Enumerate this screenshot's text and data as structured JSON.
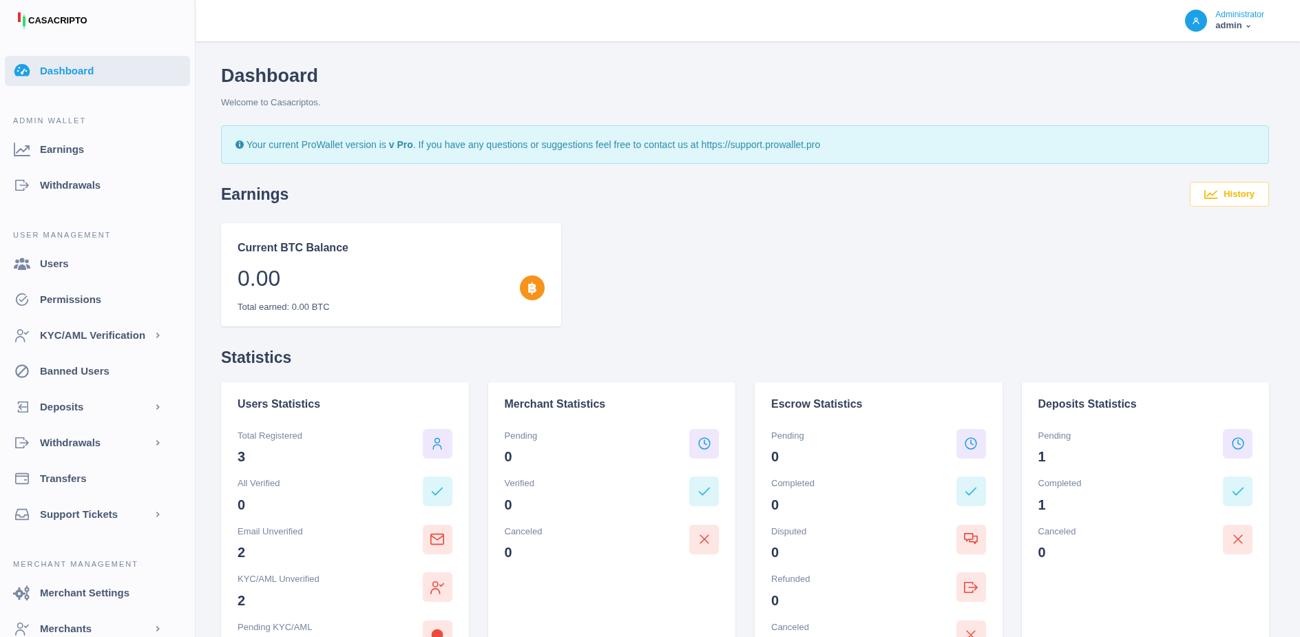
{
  "brand": "CASACRIPTO",
  "sidebar": {
    "items": [
      {
        "kind": "gauge",
        "label": "Dashboard",
        "selected": true,
        "submenu": false
      }
    ],
    "sections": [
      {
        "heading": "ADMIN WALLET",
        "items": [
          {
            "kind": "chart",
            "label": "Earnings",
            "selected": false,
            "submenu": false
          },
          {
            "kind": "exit",
            "label": "Withdrawals",
            "selected": false,
            "submenu": false
          }
        ]
      },
      {
        "heading": "USER MANAGEMENT",
        "items": [
          {
            "kind": "users",
            "label": "Users",
            "selected": false,
            "submenu": false
          },
          {
            "kind": "check-circle",
            "label": "Permissions",
            "selected": false,
            "submenu": false
          },
          {
            "kind": "user-check",
            "label": "KYC/AML Verification",
            "selected": false,
            "submenu": true
          },
          {
            "kind": "ban",
            "label": "Banned Users",
            "selected": false,
            "submenu": false
          },
          {
            "kind": "enter",
            "label": "Deposits",
            "selected": false,
            "submenu": true
          },
          {
            "kind": "exit",
            "label": "Withdrawals",
            "selected": false,
            "submenu": true
          },
          {
            "kind": "wallet",
            "label": "Transfers",
            "selected": false,
            "submenu": false
          },
          {
            "kind": "inbox",
            "label": "Support Tickets",
            "selected": false,
            "submenu": true
          }
        ]
      },
      {
        "heading": "MERCHANT MANAGEMENT",
        "items": [
          {
            "kind": "gears",
            "label": "Merchant Settings",
            "selected": false,
            "submenu": false
          },
          {
            "kind": "user-check",
            "label": "Merchants",
            "selected": false,
            "submenu": true
          }
        ]
      }
    ]
  },
  "user": {
    "role": "Administrator",
    "name": "admin"
  },
  "page": {
    "title": "Dashboard",
    "subtitle": "Welcome to Casacriptos."
  },
  "notice": {
    "text": "Your current ProWallet version is **v Pro**. If you have any questions or suggestions feel free to contact us at",
    "link": "https://support.prowallet.pro"
  },
  "earnings": {
    "heading": "Earnings",
    "history_button": "History",
    "card": {
      "title": "Current BTC Balance",
      "value": "0.00",
      "note": "Total earned: 0.00 BTC",
      "coin_symbol": "฿"
    }
  },
  "statistics": {
    "heading": "Statistics",
    "cards": [
      {
        "title": "Users Statistics",
        "items": [
          {
            "label": "Total Registered",
            "value": "3",
            "kind": "user"
          },
          {
            "label": "All Verified",
            "value": "0",
            "kind": "check"
          },
          {
            "label": "Email Unverified",
            "value": "2",
            "kind": "mail"
          },
          {
            "label": "KYC/AML Unverified",
            "value": "2",
            "kind": "user-check"
          },
          {
            "label": "Pending KYC/AML",
            "kind": "alert"
          }
        ]
      },
      {
        "title": "Merchant Statistics",
        "items": [
          {
            "label": "Pending",
            "value": "0",
            "kind": "clock"
          },
          {
            "label": "Verified",
            "value": "0",
            "kind": "check"
          },
          {
            "label": "Canceled",
            "value": "0",
            "kind": "cross"
          }
        ]
      },
      {
        "title": "Escrow Statistics",
        "items": [
          {
            "label": "Pending",
            "value": "0",
            "kind": "clock"
          },
          {
            "label": "Completed",
            "value": "0",
            "kind": "check"
          },
          {
            "label": "Disputed",
            "value": "0",
            "kind": "chat"
          },
          {
            "label": "Refunded",
            "value": "0",
            "kind": "exit"
          },
          {
            "label": "Canceled",
            "kind": "cross"
          }
        ]
      },
      {
        "title": "Deposits Statistics",
        "items": [
          {
            "label": "Pending",
            "value": "1",
            "kind": "clock"
          },
          {
            "label": "Completed",
            "value": "1",
            "kind": "check"
          },
          {
            "label": "Canceled",
            "value": "0",
            "kind": "cross"
          }
        ]
      }
    ]
  }
}
